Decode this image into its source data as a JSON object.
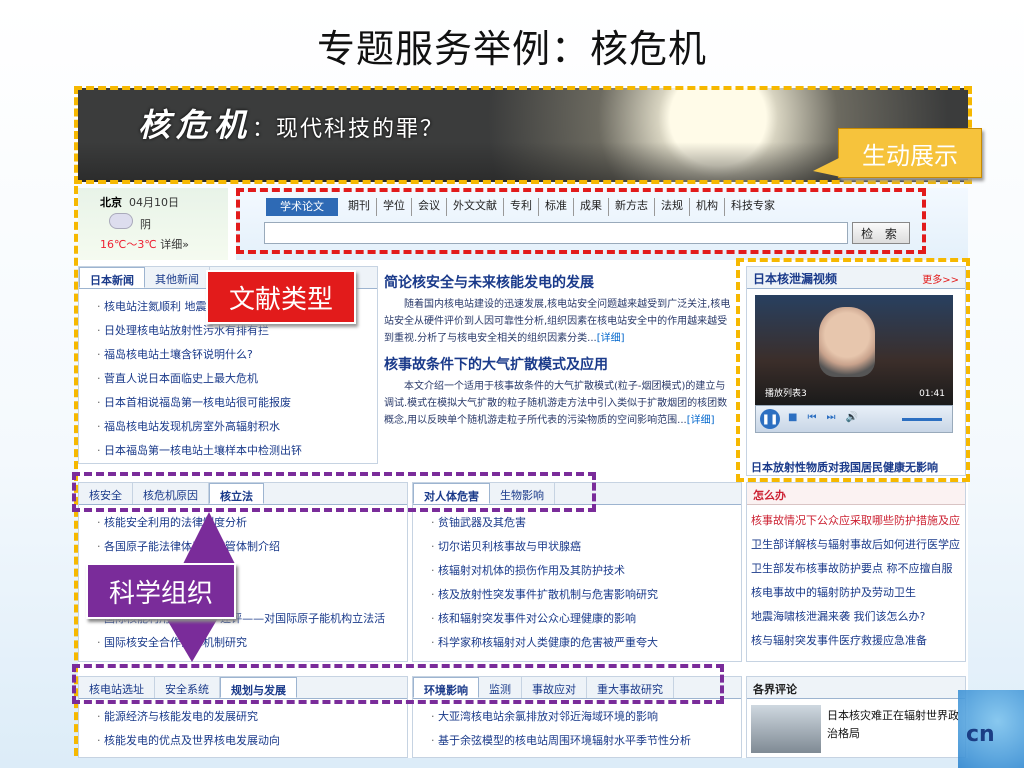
{
  "slide_title": "专题服务举例：核危机",
  "banner": {
    "title_big": "核危机",
    "title_small": "：现代科技的罪？"
  },
  "callouts": {
    "vivid": "生动展示",
    "literature": "文献类型",
    "science": "科学组织"
  },
  "weather": {
    "city": "北京",
    "date": "04月10日",
    "condition": "阴",
    "temp": "16℃～3℃",
    "detail": "详细»"
  },
  "search": {
    "tabs": [
      "学术论文",
      "期刊",
      "学位",
      "会议",
      "外文文献",
      "专利",
      "标准",
      "成果",
      "新方志",
      "法规",
      "机构",
      "科技专家"
    ],
    "button": "检 索"
  },
  "news": {
    "tabs": [
      "日本新闻",
      "其他新闻"
    ],
    "items": [
      "核电站注氮顺利 地震频发",
      "日处理核电站放射性污水有排有拦",
      "福岛核电站土壤含钚说明什么?",
      "菅直人说日本面临史上最大危机",
      "日本首相说福岛第一核电站很可能报废",
      "福岛核电站发现机房室外高辐射积水",
      "日本福岛第一核电站土壤样本中检测出钚"
    ]
  },
  "articles": [
    {
      "title": "简论核安全与未来核能发电的发展",
      "body": "随着国内核电站建设的迅速发展,核电站安全问题越来越受到广泛关注,核电站安全从硬件评价到人因可靠性分析,组织因素在核电站安全中的作用越来越受到重视.分析了与核电安全相关的组织因素分类...",
      "more": "[详细]"
    },
    {
      "title": "核事故条件下的大气扩散模式及应用",
      "body": "本文介绍一个适用于核事故条件的大气扩散模式(粒子-烟团模式)的建立与调试.模式在模拟大气扩散的粒子随机游走方法中引入类似于扩散烟团的核团数概念,用以反映单个随机游走粒子所代表的污染物质的空间影响范围...",
      "more": "[详细]"
    }
  ],
  "video": {
    "header": "日本核泄漏视频",
    "more": "更多>>",
    "caption": "播放列表3",
    "time": "01:41",
    "footer": "日本放射性物质对我国居民健康无影响"
  },
  "law": {
    "tabs": [
      "核安全",
      "核危机原因",
      "核立法"
    ],
    "items": [
      "核能安全利用的法律制度分析",
      "各国原子能法律体系及监管体制介绍",
      "中国核安全法律制度",
      "关于我国核立法的一些思考",
      "国际核能利用\"三S原则\"述评——对国际原子能机构立法活",
      "国际核安全合作法律机制研究"
    ]
  },
  "harm": {
    "tabs": [
      "对人体危害",
      "生物影响"
    ],
    "items": [
      "贫铀武器及其危害",
      "切尔诺贝利核事故与甲状腺癌",
      "核辐射对机体的损伤作用及其防护技术",
      "核及放射性突发事件扩散机制与危害影响研究",
      "核和辐射突发事件对公众心理健康的影响",
      "科学家称核辐射对人类健康的危害被严重夸大"
    ]
  },
  "what": {
    "header": "怎么办",
    "items": [
      "核事故情况下公众应采取哪些防护措施及应",
      "卫生部详解核与辐射事故后如何进行医学应",
      "卫生部发布核事故防护要点 称不应擅自服",
      "核电事故中的辐射防护及劳动卫生",
      "地震海啸核泄漏来袭 我们该怎么办?",
      "核与辐射突发事件医疗救援应急准备"
    ]
  },
  "plan": {
    "tabs": [
      "核电站选址",
      "安全系统",
      "规划与发展"
    ],
    "items": [
      "能源经济与核能发电的发展研究",
      "核能发电的优点及世界核电发展动向"
    ]
  },
  "env": {
    "tabs": [
      "环境影响",
      "监测",
      "事故应对",
      "重大事故研究"
    ],
    "items": [
      "大亚湾核电站余氯排放对邻近海域环境的影响",
      "基于余弦模型的核电站周围环境辐射水平季节性分析"
    ]
  },
  "comment": {
    "header": "各界评论",
    "text": "日本核灾难正在辐射世界政治格局"
  },
  "corner": "cn"
}
